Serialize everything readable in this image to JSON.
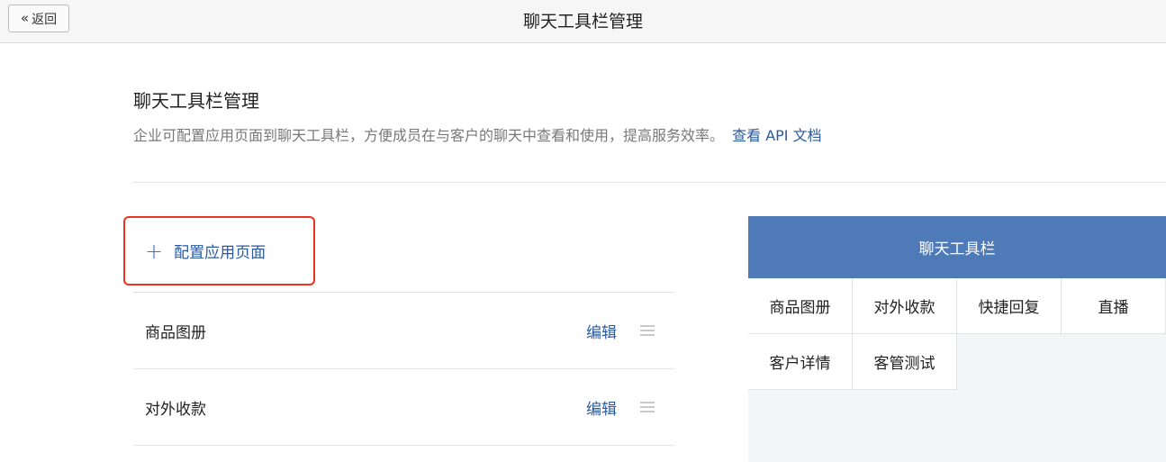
{
  "header": {
    "back_icon": "double-chevron-left-icon",
    "back_glyph": "«",
    "back_label": "返回",
    "title": "聊天工具栏管理"
  },
  "section": {
    "title": "聊天工具栏管理",
    "description": "企业可配置应用页面到聊天工具栏，方便成员在与客户的聊天中查看和使用，提高服务效率。",
    "doc_link": "查看 API 文档"
  },
  "config_button": {
    "icon": "plus-icon",
    "icon_glyph": "+",
    "label": "配置应用页面",
    "highlight_color": "#e8331f"
  },
  "list": {
    "items": [
      {
        "name": "商品图册",
        "edit_label": "编辑"
      },
      {
        "name": "对外收款",
        "edit_label": "编辑"
      }
    ]
  },
  "preview": {
    "title": "聊天工具栏",
    "header_color": "#4e7bb7",
    "cells": [
      "商品图册",
      "对外收款",
      "快捷回复",
      "直播",
      "客户详情",
      "客管测试"
    ]
  },
  "colors": {
    "link": "#2b5a9c",
    "accent": "#4e7bb7"
  }
}
